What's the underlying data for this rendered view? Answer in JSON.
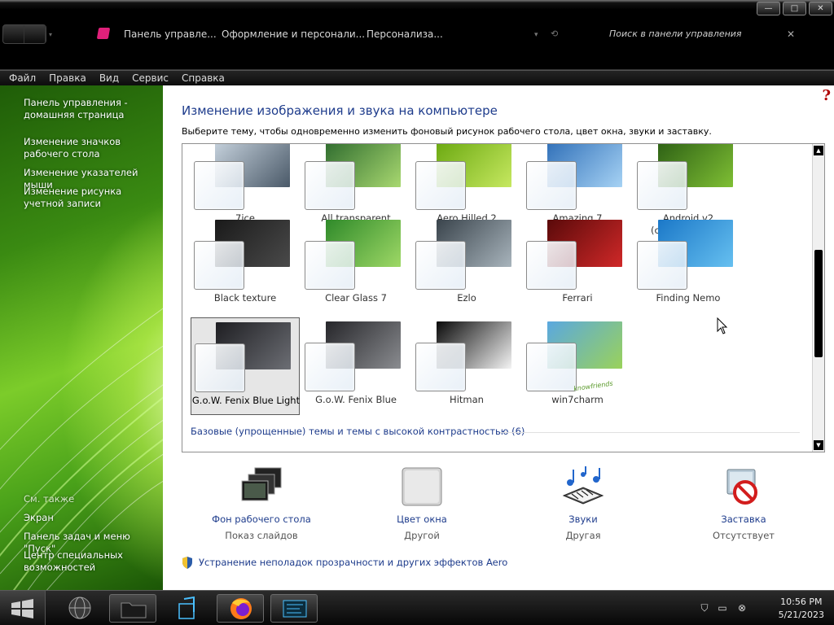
{
  "window": {
    "breadcrumbs": [
      "Панель управле...",
      "Оформление и персонали...",
      "Персонализа..."
    ],
    "search_placeholder": "Поиск в панели управления",
    "buttons": {
      "minimize": "—",
      "maximize": "□",
      "close": "✕"
    }
  },
  "menu": [
    "Файл",
    "Правка",
    "Вид",
    "Сервис",
    "Справка"
  ],
  "sidebar": {
    "links": [
      "Панель управления - домашняя страница",
      "Изменение значков рабочего стола",
      "Изменение указателей мыши",
      "Изменение рисунка учетной записи"
    ],
    "see_also_label": "См. также",
    "see_also": [
      "Экран",
      "Панель задач и меню \"Пуск\"",
      "Центр специальных возможностей"
    ]
  },
  "main": {
    "help": "?",
    "title": "Изменение изображения и звука на компьютере",
    "subtitle": "Выберите тему, чтобы одновременно изменить фоновый рисунок рабочего стола, цвет окна, звуки и заставку.",
    "themes": [
      {
        "label": "7ice",
        "colors": [
          "#c7d3de",
          "#4a5968"
        ]
      },
      {
        "label": "All transparent",
        "colors": [
          "#2e6b2e",
          "#a8d870"
        ]
      },
      {
        "label": "Aero Hilled 2",
        "colors": [
          "#6aa810",
          "#c6e860"
        ]
      },
      {
        "label": "Amazing 7",
        "colors": [
          "#2f6fb8",
          "#a6d2f4"
        ]
      },
      {
        "label": "Android v2 (class)tochpc.ru",
        "colors": [
          "#2c5f14",
          "#7fbf34"
        ]
      },
      {
        "label": "Black texture",
        "colors": [
          "#1a1a1a",
          "#4a4a4a"
        ]
      },
      {
        "label": "Clear Glass 7",
        "colors": [
          "#2f8a2a",
          "#9ed866"
        ]
      },
      {
        "label": "Ezlo",
        "colors": [
          "#3a444c",
          "#a8b4bc"
        ]
      },
      {
        "label": "Ferrari",
        "colors": [
          "#5a0a0a",
          "#d02828"
        ]
      },
      {
        "label": "Finding Nemo",
        "colors": [
          "#1b78c8",
          "#66c0f0"
        ]
      },
      {
        "label": "G.o.W. Fenix Blue Light",
        "colors": [
          "#1e1e22",
          "#6c6e74"
        ],
        "selected": true
      },
      {
        "label": "G.o.W. Fenix Blue",
        "colors": [
          "#26262a",
          "#8a8c90"
        ]
      },
      {
        "label": "Hitman",
        "colors": [
          "#0a0a0a",
          "#f4f4f4"
        ]
      },
      {
        "label": "win7charm",
        "colors": [
          "#5aa8e0",
          "#9ad25a"
        ]
      }
    ],
    "win7charm_watermark": "knowfriends",
    "basic_themes_link": "Базовые (упрощенные) темы и темы с высокой контрастностью (6)",
    "bottom": [
      {
        "title": "Фон рабочего стола",
        "sub": "Показ слайдов",
        "icon": "desktop-background-icon"
      },
      {
        "title": "Цвет окна",
        "sub": "Другой",
        "icon": "window-color-icon"
      },
      {
        "title": "Звуки",
        "sub": "Другая",
        "icon": "sounds-icon"
      },
      {
        "title": "Заставка",
        "sub": "Отсутствует",
        "icon": "screensaver-icon"
      }
    ],
    "aero_link": "Устранение неполадок прозрачности и других эффектов Aero"
  },
  "taskbar": {
    "time": "10:56 PM",
    "date": "5/21/2023"
  }
}
